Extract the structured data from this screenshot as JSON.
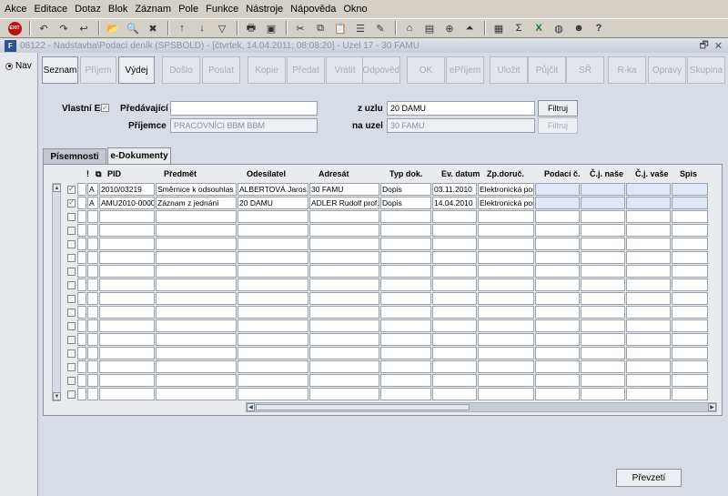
{
  "menu": [
    "Akce",
    "Editace",
    "Dotaz",
    "Blok",
    "Záznam",
    "Pole",
    "Funkce",
    "Nástroje",
    "Nápověda",
    "Okno"
  ],
  "toolbar": {
    "exit_label": "EXIT",
    "icons": [
      "save-icon",
      "print-icon",
      "cut-icon",
      "copy-icon",
      "paste-icon",
      "sort-asc-icon",
      "sort-desc-icon",
      "filter-icon",
      "clear-icon",
      "find-icon",
      "tree-icon",
      "calendar-icon",
      "sigma-icon",
      "excel-icon",
      "help-icon"
    ],
    "sigma": "Σ",
    "help": "?"
  },
  "window": {
    "title": "08122 - Nadstavba\\Podací deník (SPSBOLD) - [čtvrtek, 14.04.2011; 08:08:20] - Uzel 17 - 30 FAMU",
    "restore": "🗗",
    "close": "✕"
  },
  "nav": {
    "label": "Nav"
  },
  "actions": [
    {
      "label": "Seznam",
      "enabled": true
    },
    {
      "label": "Příjem",
      "enabled": false
    },
    {
      "label": "Výdej",
      "enabled": true
    },
    {
      "label": "Došlo",
      "enabled": false
    },
    {
      "label": "Poslat",
      "enabled": false
    },
    {
      "label": "Kopie",
      "enabled": false
    },
    {
      "label": "Předat",
      "enabled": false
    },
    {
      "label": "Vrátit",
      "enabled": false
    },
    {
      "label": "Odpověď",
      "enabled": false
    },
    {
      "label": "OK",
      "enabled": false
    },
    {
      "label": "ePříjem",
      "enabled": false
    },
    {
      "label": "Uložit",
      "enabled": false
    },
    {
      "label": "Půjčit",
      "enabled": false
    },
    {
      "label": "SŘ",
      "enabled": false
    },
    {
      "label": "R-ka",
      "enabled": false
    },
    {
      "label": "Opravy",
      "enabled": false
    },
    {
      "label": "Skupina",
      "enabled": false
    }
  ],
  "form": {
    "vlastni_ej_label": "Vlastní EJ",
    "predavajici_label": "Předávající",
    "predavajici_value": "",
    "prijemce_label": "Příjemce",
    "prijemce_value": "PRACOVNÍCI BBM BBM",
    "z_uzlu_label": "z uzlu",
    "z_uzlu_value": "20 DAMU",
    "na_uzel_label": "na uzel",
    "na_uzel_value": "30 FAMU",
    "filtruj1": "Filtruj",
    "filtruj2": "Filtruj"
  },
  "tabs": [
    "Písemnosti",
    "e-Dokumenty"
  ],
  "grid": {
    "headers": [
      "!",
      "PID",
      "Předmět",
      "Odesílatel",
      "Adresát",
      "Typ dok.",
      "Ev. datum",
      "Zp.doruč.",
      "Podací č.",
      "Č.j. naše",
      "Č.j. vaše",
      "Spis"
    ],
    "rows": [
      {
        "flag": "A",
        "pid": "2010/03219",
        "predmet": "Směrnice k odsouhlas",
        "odesilatel": "ALBERTOVÁ Jaros",
        "adresat": "30 FAMU",
        "typ": "Dopis",
        "datum": "03.11.2010",
        "zpusob": "Elektronická poš"
      },
      {
        "flag": "A",
        "pid": "AMU2010-0000",
        "predmet": "Záznam z jednání",
        "odesilatel": "20 DAMU",
        "adresat": "ADLER Rudolf prof.",
        "typ": "Dopis",
        "datum": "14.04.2010",
        "zpusob": "Elektronická poš"
      }
    ],
    "checked": [
      true,
      true
    ]
  },
  "prevzeti_label": "Převzetí"
}
